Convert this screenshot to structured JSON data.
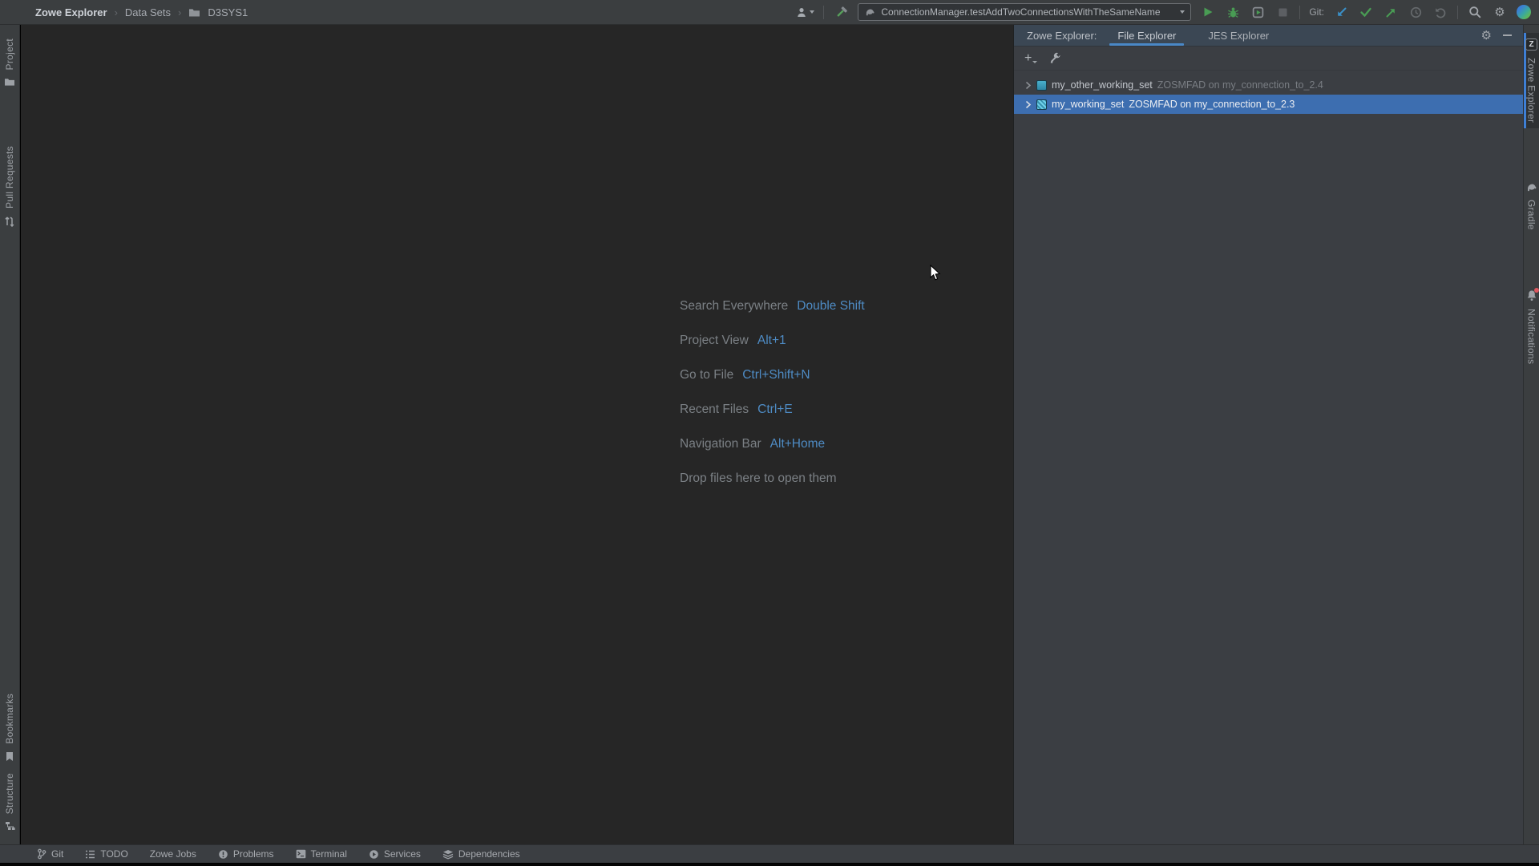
{
  "topbar": {
    "breadcrumb": [
      "Zowe Explorer",
      "Data Sets",
      "D3SYS1"
    ],
    "run_config": "ConnectionManager.testAddTwoConnectionsWithTheSameName",
    "git_label": "Git:"
  },
  "left_stripe": {
    "items": [
      {
        "label": "Project"
      },
      {
        "label": "Pull Requests"
      },
      {
        "label": "Bookmarks"
      },
      {
        "label": "Structure"
      }
    ]
  },
  "editor": {
    "shortcuts": [
      {
        "label": "Search Everywhere",
        "keys": "Double Shift"
      },
      {
        "label": "Project View",
        "keys": "Alt+1"
      },
      {
        "label": "Go to File",
        "keys": "Ctrl+Shift+N"
      },
      {
        "label": "Recent Files",
        "keys": "Ctrl+E"
      },
      {
        "label": "Navigation Bar",
        "keys": "Alt+Home"
      },
      {
        "label": "Drop files here to open them",
        "keys": ""
      }
    ]
  },
  "right_panel": {
    "title": "Zowe Explorer:",
    "tabs": [
      {
        "label": "File Explorer",
        "active": true
      },
      {
        "label": "JES Explorer",
        "active": false
      }
    ],
    "tree": [
      {
        "name": "my_other_working_set",
        "detail": "ZOSMFAD on my_connection_to_2.4",
        "selected": false
      },
      {
        "name": "my_working_set",
        "detail": "ZOSMFAD on my_connection_to_2.3",
        "selected": true
      }
    ]
  },
  "right_stripe": {
    "items": [
      {
        "label": "Zowe Explorer",
        "active": true
      },
      {
        "label": "Gradle",
        "active": false
      },
      {
        "label": "Notifications",
        "active": false
      }
    ]
  },
  "bottombar": {
    "items": [
      {
        "label": "Git"
      },
      {
        "label": "TODO"
      },
      {
        "label": "Zowe Jobs"
      },
      {
        "label": "Problems"
      },
      {
        "label": "Terminal"
      },
      {
        "label": "Services"
      },
      {
        "label": "Dependencies"
      }
    ]
  },
  "icons": {
    "plus": "+",
    "breadcrumb_sep": "›",
    "gear": "⚙",
    "zowe_z": "Z"
  },
  "colors": {
    "topbar_bg": "#3b3e40",
    "editor_bg": "#262626",
    "panel_bg": "#3b3e43",
    "panel_header_bg": "#3b4754",
    "tab_underline": "#4a88c7",
    "selection_blue": "#3d6eb0",
    "shortcut_key_blue": "#4e8bc4",
    "run_green": "#499c54",
    "git_update_blue": "#3a90c8",
    "notification_red": "#db5860"
  }
}
